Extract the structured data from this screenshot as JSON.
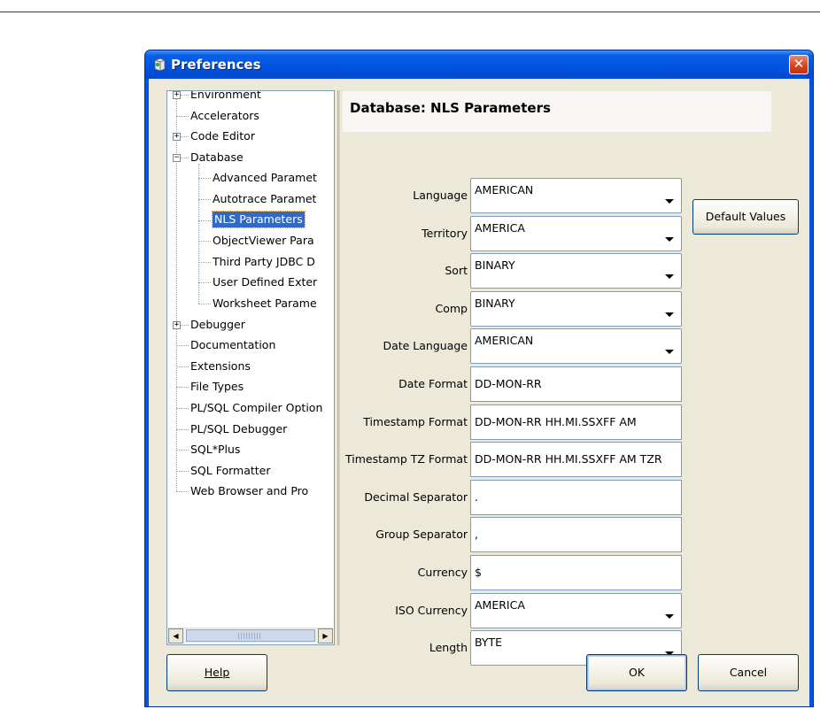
{
  "window": {
    "title": "Preferences",
    "close_glyph": "✕"
  },
  "tree": {
    "items": [
      {
        "label": "Environment",
        "level": 0,
        "expander": "+"
      },
      {
        "label": "Accelerators",
        "level": 0,
        "expander": ""
      },
      {
        "label": "Code Editor",
        "level": 0,
        "expander": "+"
      },
      {
        "label": "Database",
        "level": 0,
        "expander": "−"
      },
      {
        "label": "Advanced Paramet",
        "level": 1,
        "expander": ""
      },
      {
        "label": "Autotrace Paramet",
        "level": 1,
        "expander": ""
      },
      {
        "label": "NLS Parameters",
        "level": 1,
        "expander": "",
        "selected": true
      },
      {
        "label": "ObjectViewer Para",
        "level": 1,
        "expander": ""
      },
      {
        "label": "Third Party JDBC D",
        "level": 1,
        "expander": ""
      },
      {
        "label": "User Defined Exter",
        "level": 1,
        "expander": ""
      },
      {
        "label": "Worksheet Parame",
        "level": 1,
        "expander": ""
      },
      {
        "label": "Debugger",
        "level": 0,
        "expander": "+"
      },
      {
        "label": "Documentation",
        "level": 0,
        "expander": ""
      },
      {
        "label": "Extensions",
        "level": 0,
        "expander": ""
      },
      {
        "label": "File Types",
        "level": 0,
        "expander": ""
      },
      {
        "label": "PL/SQL Compiler Option",
        "level": 0,
        "expander": ""
      },
      {
        "label": "PL/SQL Debugger",
        "level": 0,
        "expander": ""
      },
      {
        "label": "SQL*Plus",
        "level": 0,
        "expander": ""
      },
      {
        "label": "SQL Formatter",
        "level": 0,
        "expander": ""
      },
      {
        "label": "Web Browser and Pro",
        "level": 0,
        "expander": ""
      }
    ],
    "scroll_left_glyph": "◀",
    "scroll_right_glyph": "▶"
  },
  "pane": {
    "title": "Database: NLS Parameters",
    "default_values_label": "Default Values",
    "fields": [
      {
        "label": "Language",
        "value": "AMERICAN",
        "kind": "combo"
      },
      {
        "label": "Territory",
        "value": "AMERICA",
        "kind": "combo"
      },
      {
        "label": "Sort",
        "value": "BINARY",
        "kind": "combo"
      },
      {
        "label": "Comp",
        "value": "BINARY",
        "kind": "combo"
      },
      {
        "label": "Date Language",
        "value": "AMERICAN",
        "kind": "combo"
      },
      {
        "label": "Date Format",
        "value": "DD-MON-RR",
        "kind": "text"
      },
      {
        "label": "Timestamp Format",
        "value": "DD-MON-RR HH.MI.SSXFF AM",
        "kind": "text"
      },
      {
        "label": "Timestamp TZ Format",
        "value": "DD-MON-RR HH.MI.SSXFF AM TZR",
        "kind": "text"
      },
      {
        "label": "Decimal Separator",
        "value": ".",
        "kind": "text"
      },
      {
        "label": "Group Separator",
        "value": ",",
        "kind": "text"
      },
      {
        "label": "Currency",
        "value": "$",
        "kind": "text"
      },
      {
        "label": "ISO Currency",
        "value": "AMERICA",
        "kind": "combo"
      },
      {
        "label": "Length",
        "value": "BYTE",
        "kind": "combo"
      }
    ]
  },
  "buttons": {
    "help": "Help",
    "ok": "OK",
    "cancel": "Cancel"
  },
  "icons": {
    "title": "app-icon",
    "close": "close-icon",
    "dropdown": "chevron-down-icon"
  }
}
